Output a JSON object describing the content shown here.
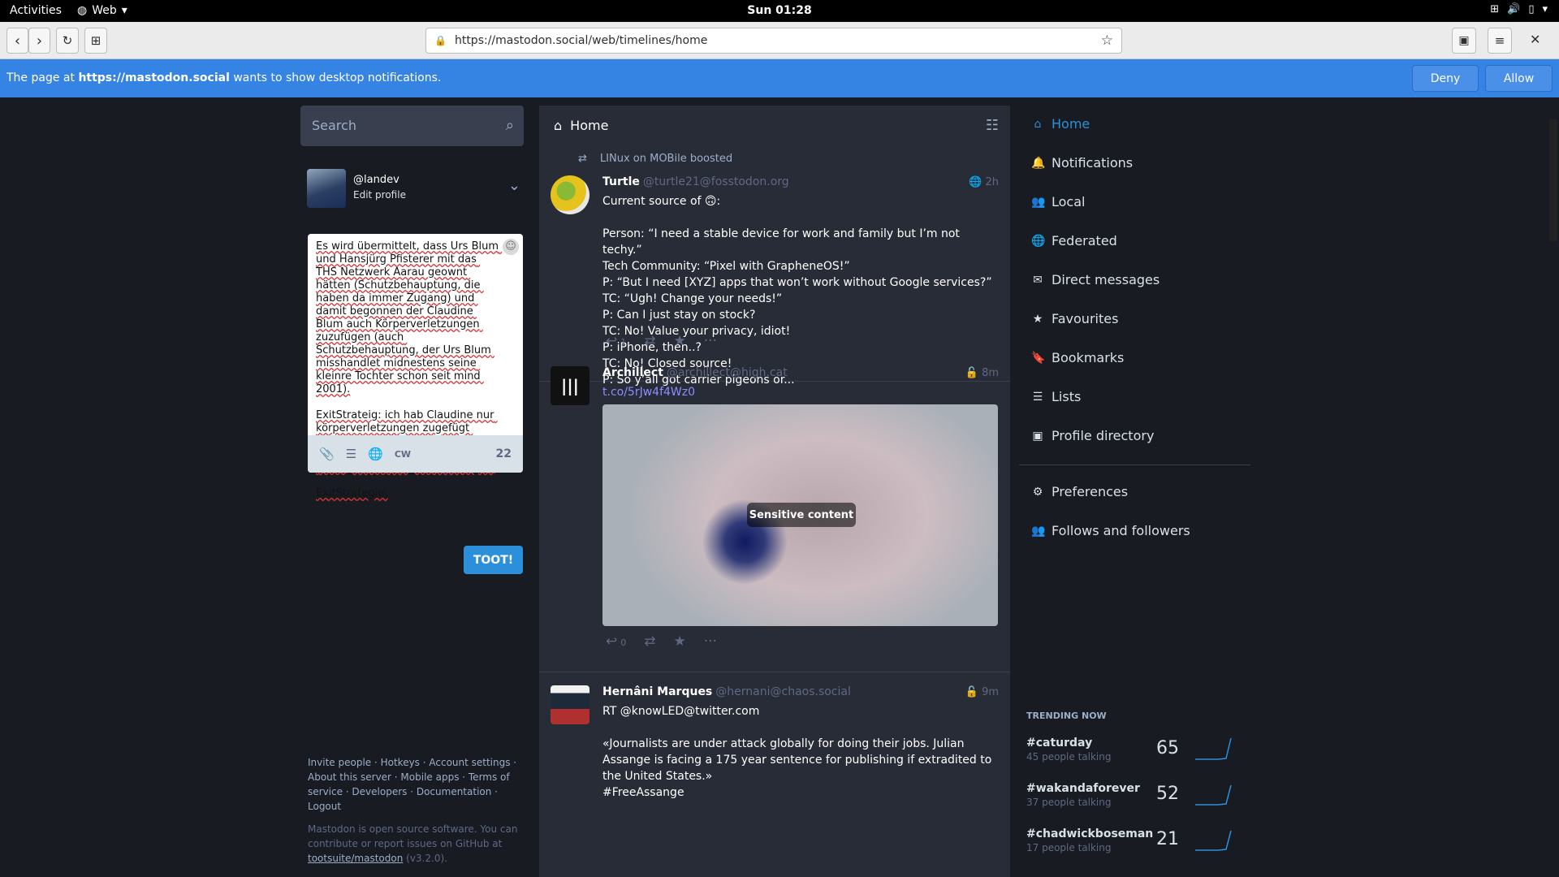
{
  "system": {
    "activities": "Activities",
    "app_name": "Web",
    "clock": "Sun 01:28"
  },
  "browser": {
    "url": "https://mastodon.social/web/timelines/home"
  },
  "notification": {
    "prefix": "The page at ",
    "site": "https://mastodon.social",
    "suffix": " wants to show desktop notifications.",
    "deny": "Deny",
    "allow": "Allow"
  },
  "search": {
    "placeholder": "Search"
  },
  "profile": {
    "handle": "@landev",
    "edit": "Edit profile"
  },
  "compose": {
    "text": "Es wird übermittelt, dass Urs Blum und Hansjürg Pfisterer mit das THS Netzwerk Aarau geownt hätten (Schutzbehauptung, die haben da immer Zugang) und damit begonnen der Claudine Blum auch Körperverletzungen zuzufügen (auch Schutzbehauptung, der Urs Blum misshandlet midnestens seine kleinre Tochter schon seit mind 2001).\n\nExitStrateig: ich hab Claudine nur körperverletzungen zugefügt damit wir Marc jr's computer ownen können.\n -> objektfixierung auf das Objekt\n\nExitStrategie:",
    "cw": "CW",
    "count": "22",
    "toot": "TOOT!"
  },
  "footer": {
    "line1": "Invite people · Hotkeys · Account settings ·",
    "line2": "About this server · Mobile apps · Terms of",
    "line3": "service · Developers · Documentation · Logout",
    "about1": "Mastodon is open source software. You can",
    "about2": "contribute or report issues on GitHub at",
    "about3_link": "tootsuite/mastodon",
    "about3_rest": " (v3.2.0)."
  },
  "column": {
    "title": "Home"
  },
  "statuses": [
    {
      "boosted_by": "LINux on MOBile boosted",
      "name": "Turtle",
      "acct": "@turtle21@fosstodon.org",
      "time": "2h",
      "body": "Current source of 🙃:\n\nPerson: “I need a stable device for work and family but I’m not techy.”\nTech Community: “Pixel with GrapheneOS!”\nP: “But I need [XYZ] apps that won’t work without Google services?”\nTC: “Ugh! Change your needs!”\nP: Can I just stay on stock?\nTC: No! Value your privacy, idiot!\nP: iPhone, then..?\nTC: No! Closed source!\nP: So y’all got carrier pigeons or...",
      "replies": "1"
    },
    {
      "name": "Archillect",
      "acct": "@archillect@high.cat",
      "time": "8m",
      "link": "t.co/5rJw4f4Wz0",
      "sensitive": "Sensitive content",
      "replies": "0"
    },
    {
      "name": "Hernâni Marques",
      "acct": "@hernani@chaos.social",
      "time": "9m",
      "body": "RT @knowLED@twitter.com\n\n«Journalists are under attack globally for doing their jobs. Julian Assange is facing a 175 year sentence for publishing if extradited to the United States.»\n#FreeAssange"
    }
  ],
  "nav": [
    {
      "label": "Home",
      "icon": "home-icon"
    },
    {
      "label": "Notifications",
      "icon": "bell-icon"
    },
    {
      "label": "Local",
      "icon": "users-icon"
    },
    {
      "label": "Federated",
      "icon": "globe-icon"
    },
    {
      "label": "Direct messages",
      "icon": "envelope-icon"
    },
    {
      "label": "Favourites",
      "icon": "star-icon"
    },
    {
      "label": "Bookmarks",
      "icon": "bookmark-icon"
    },
    {
      "label": "Lists",
      "icon": "list-icon"
    },
    {
      "label": "Profile directory",
      "icon": "address-book-icon"
    },
    {
      "label": "Preferences",
      "icon": "gear-icon"
    },
    {
      "label": "Follows and followers",
      "icon": "users-icon"
    }
  ],
  "trending": {
    "title": "TRENDING NOW",
    "items": [
      {
        "tag": "#caturday",
        "talking": "45 people talking",
        "count": "65"
      },
      {
        "tag": "#wakandaforever",
        "talking": "37 people talking",
        "count": "52"
      },
      {
        "tag": "#chadwickboseman",
        "talking": "17 people talking",
        "count": "21"
      }
    ]
  },
  "colors": {
    "accent": "#2b90d9",
    "notification_bar": "#3584e4",
    "background": "#191b22",
    "column": "#282c37"
  }
}
